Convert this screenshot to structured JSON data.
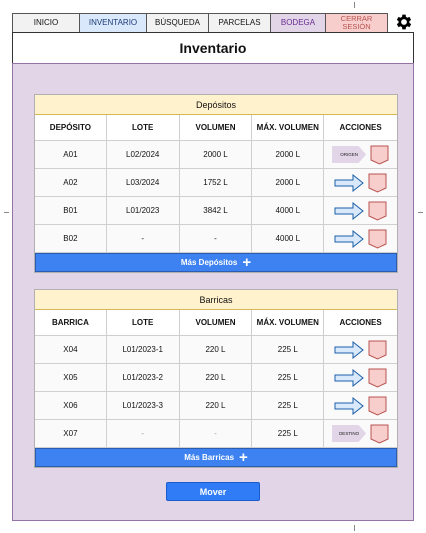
{
  "nav": {
    "tabs": [
      {
        "label": "INICIO"
      },
      {
        "label": "INVENTARIO"
      },
      {
        "label": "BÚSQUEDA"
      },
      {
        "label": "PARCELAS"
      },
      {
        "label": "BODEGA"
      },
      {
        "label": "CERRAR SESIÓN"
      }
    ],
    "gear_icon": "gear-icon"
  },
  "page": {
    "title": "Inventario"
  },
  "depositos": {
    "title": "Depósitos",
    "headers": [
      "DEPÓSITO",
      "LOTE",
      "VOLUMEN",
      "MÁX. VOLUMEN",
      "ACCIONES"
    ],
    "rows": [
      {
        "id": "A01",
        "lote": "L02/2024",
        "volumen": "2000 L",
        "max": "2000 L",
        "action": "ORIGEN"
      },
      {
        "id": "A02",
        "lote": "L03/2024",
        "volumen": "1752 L",
        "max": "2000 L",
        "action": "arrow"
      },
      {
        "id": "B01",
        "lote": "L01/2023",
        "volumen": "3842 L",
        "max": "4000 L",
        "action": "arrow"
      },
      {
        "id": "B02",
        "lote": "-",
        "volumen": "-",
        "max": "4000 L",
        "action": "arrow"
      }
    ],
    "more_label": "Más Depósitos"
  },
  "barricas": {
    "title": "Barricas",
    "headers": [
      "BARRICA",
      "LOTE",
      "VOLUMEN",
      "MÁX. VOLUMEN",
      "ACCIONES"
    ],
    "rows": [
      {
        "id": "X04",
        "lote": "L01/2023-1",
        "volumen": "220 L",
        "max": "225 L",
        "action": "arrow"
      },
      {
        "id": "X05",
        "lote": "L01/2023-2",
        "volumen": "220 L",
        "max": "225 L",
        "action": "arrow"
      },
      {
        "id": "X06",
        "lote": "L01/2023-3",
        "volumen": "220 L",
        "max": "225 L",
        "action": "arrow"
      },
      {
        "id": "X07",
        "lote": "-",
        "volumen": "-",
        "max": "225 L",
        "action": "DESTINO"
      }
    ],
    "more_label": "Más Barricas"
  },
  "mover_label": "Mover",
  "colors": {
    "panel": "#e1d5e7",
    "table_title": "#fff2cc",
    "button_blue": "#3d82f0",
    "arrow_fill": "#dae8fc",
    "arrow_stroke": "#1b5fa6",
    "shield_fill": "#f8cecc"
  }
}
